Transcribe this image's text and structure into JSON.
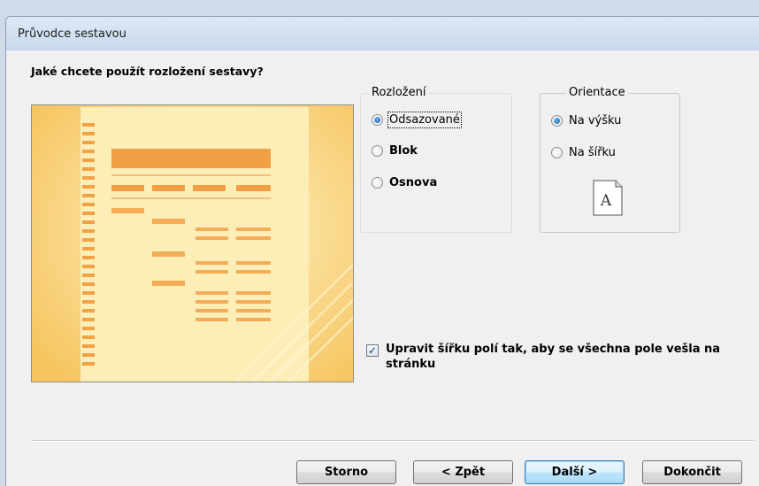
{
  "window": {
    "title": "Průvodce sestavou"
  },
  "question": "Jaké chcete použít rozložení sestavy?",
  "layout_group": {
    "label": "Rozložení",
    "options": [
      {
        "label": "Odsazované",
        "selected": true
      },
      {
        "label": "Blok",
        "selected": false
      },
      {
        "label": "Osnova",
        "selected": false
      }
    ]
  },
  "orientation_group": {
    "label": "Orientace",
    "options": [
      {
        "label": "Na výšku",
        "selected": true
      },
      {
        "label": "Na šířku",
        "selected": false
      }
    ],
    "page_icon_letter": "A"
  },
  "adjust_width": {
    "checked": true,
    "label": "Upravit šířku polí tak, aby se všechna pole vešla na stránku"
  },
  "buttons": {
    "cancel": "Storno",
    "back": "< Zpět",
    "next": "Další >",
    "finish": "Dokončit"
  },
  "colors": {
    "preview_bg": "#fbe4a0",
    "preview_accent": "#f0a042",
    "title_bar": "#d4e1f0"
  }
}
